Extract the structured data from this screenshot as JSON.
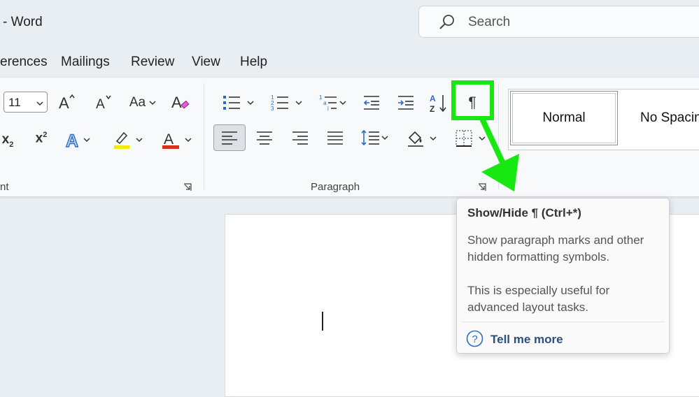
{
  "titlebar": {
    "title": "-  Word"
  },
  "search": {
    "placeholder": "Search"
  },
  "tabs": [
    "erences",
    "Mailings",
    "Review",
    "View",
    "Help"
  ],
  "font": {
    "size": "11",
    "group_label": "nt",
    "change_case": "Aa",
    "subscript_letter": "x",
    "subscript_index": "2",
    "superscript_letter": "x",
    "superscript_index": "2"
  },
  "paragraph": {
    "group_label": "Paragraph",
    "show_hide_symbol": "¶"
  },
  "styles": {
    "items": [
      "Normal",
      "No Spacin"
    ]
  },
  "tooltip": {
    "title": "Show/Hide ¶ (Ctrl+*)",
    "line1": "Show paragraph marks and other hidden formatting symbols.",
    "line2": "This is especially useful for advanced layout tasks.",
    "link": "Tell me more"
  },
  "colors": {
    "highlight_green": "#18e812",
    "highlight_yellow": "#f4e90f",
    "font_red": "#d9301c",
    "accent_blue": "#2b6cc4",
    "link_blue": "#2b4f7e"
  }
}
